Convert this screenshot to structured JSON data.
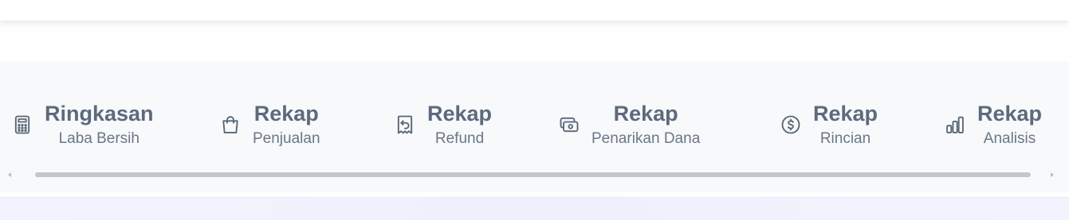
{
  "tabs": [
    {
      "title": "Ringkasan",
      "subtitle": "Laba Bersih",
      "icon": "calculator-icon"
    },
    {
      "title": "Rekap",
      "subtitle": "Penjualan",
      "icon": "shopping-bag-icon"
    },
    {
      "title": "Rekap",
      "subtitle": "Refund",
      "icon": "receipt-refund-icon"
    },
    {
      "title": "Rekap",
      "subtitle": "Penarikan Dana",
      "icon": "cash-withdraw-icon"
    },
    {
      "title": "Rekap",
      "subtitle": "Rincian",
      "icon": "dollar-circle-icon"
    },
    {
      "title": "Rekap",
      "subtitle": "Analisis",
      "icon": "bar-chart-icon"
    }
  ],
  "colors": {
    "text_primary": "#5d6a7c",
    "text_secondary": "#6b7787",
    "strip_background": "#f7f9fb",
    "scrollbar": "#c3c6cb"
  }
}
